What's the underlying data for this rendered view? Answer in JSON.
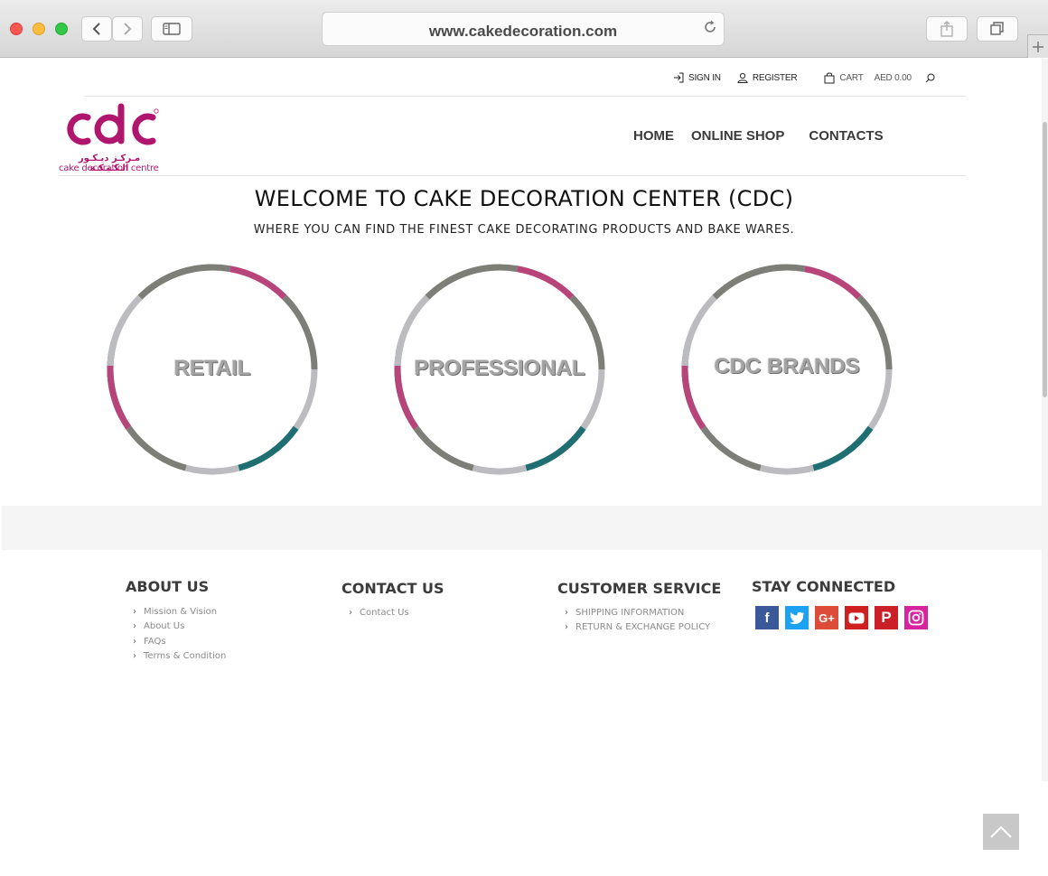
{
  "browser": {
    "url": "www.cakedecoration.com"
  },
  "topbar": {
    "sign_in": "SIGN IN",
    "register": "REGISTER",
    "cart": "CART",
    "cart_total": "AED 0.00"
  },
  "logo": {
    "mark": "cdc",
    "arabic": "مـركـز ديـكـور الـكـيـكـة",
    "english": "cake decoration centre"
  },
  "nav": {
    "items": [
      "HOME",
      "ONLINE SHOP",
      "CONTACTS"
    ]
  },
  "hero": {
    "title": "WELCOME TO CAKE DECORATION CENTER (CDC)",
    "subtitle": "WHERE YOU CAN FIND THE FINEST CAKE DECORATING PRODUCTS AND BAKE WARES."
  },
  "categories": [
    {
      "label": "RETAIL"
    },
    {
      "label": "PROFESSIONAL"
    },
    {
      "label": "CDC BRANDS"
    }
  ],
  "footer": {
    "about": {
      "heading": "ABOUT US",
      "links": [
        "Mission & Vision",
        "About Us",
        "FAQs",
        "Terms & Condition"
      ]
    },
    "contact": {
      "heading": "CONTACT US",
      "links": [
        "Contact Us"
      ]
    },
    "service": {
      "heading": "CUSTOMER SERVICE",
      "links": [
        "SHIPPING INFORMATION",
        "RETURN & EXCHANGE POLICY"
      ]
    },
    "social": {
      "heading": "STAY CONNECTED",
      "icons": [
        "facebook-icon",
        "twitter-icon",
        "google-plus-icon",
        "youtube-icon",
        "pinterest-icon",
        "instagram-icon"
      ]
    }
  },
  "colors": {
    "brand": "#b0166e",
    "ring_teal": "#1e6e72",
    "ring_pink": "#b8457a",
    "ring_dark": "#7e7e78",
    "ring_light": "#bcbcc0"
  }
}
